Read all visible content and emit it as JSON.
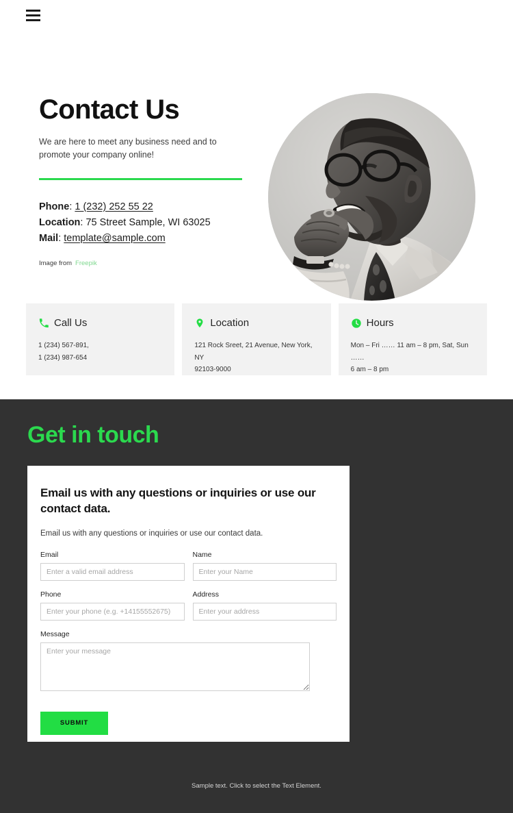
{
  "nav": {
    "menu_label": "Menu",
    "menu_icon": "hamburger-icon"
  },
  "hero": {
    "title": "Contact Us",
    "subtitle": "We are here to meet any business need and to promote your company online!",
    "phone_label": "Phone",
    "phone_value": "1 (232) 252 55 22",
    "location_label": "Location",
    "location_value": "75 Street Sample, WI 63025",
    "mail_label": "Mail",
    "mail_value": "template@sample.com",
    "credit_text": "Image from",
    "credit_link": "Freepik",
    "photo_alt": "Portrait of a smiling bearded man with glasses"
  },
  "cards": [
    {
      "icon": "phone-icon",
      "title": "Call Us",
      "line1": "1 (234) 567-891,",
      "line2": "1 (234) 987-654"
    },
    {
      "icon": "map-pin-icon",
      "title": "Location",
      "line1": "121 Rock Sreet, 21 Avenue, New York, NY",
      "line2": "92103-9000"
    },
    {
      "icon": "clock-icon",
      "title": "Hours",
      "line1": "Mon – Fri …… 11 am – 8 pm, Sat, Sun  ……",
      "line2": "6 am – 8 pm"
    }
  ],
  "dark_section": {
    "title": "Get in touch",
    "footer_note": "Sample text. Click to select the Text Element."
  },
  "form": {
    "heading": "Email us with any questions or inquiries or use our contact data.",
    "description": "Email us with any questions or inquiries or use our contact data.",
    "fields": {
      "email": {
        "label": "Email",
        "placeholder": "Enter a valid email address",
        "value": ""
      },
      "name": {
        "label": "Name",
        "placeholder": "Enter your Name",
        "value": ""
      },
      "phone": {
        "label": "Phone",
        "placeholder": "Enter your phone (e.g. +14155552675)",
        "value": ""
      },
      "address": {
        "label": "Address",
        "placeholder": "Enter your address",
        "value": ""
      },
      "message": {
        "label": "Message",
        "placeholder": "Enter your message",
        "value": ""
      }
    },
    "submit_label": "SUBMIT"
  },
  "colors": {
    "accent_green": "#22dd44",
    "rule_green": "#2bd94e",
    "dark_bg": "#323232",
    "card_bg": "#f2f2f2",
    "credit_green": "#7fd88f"
  }
}
